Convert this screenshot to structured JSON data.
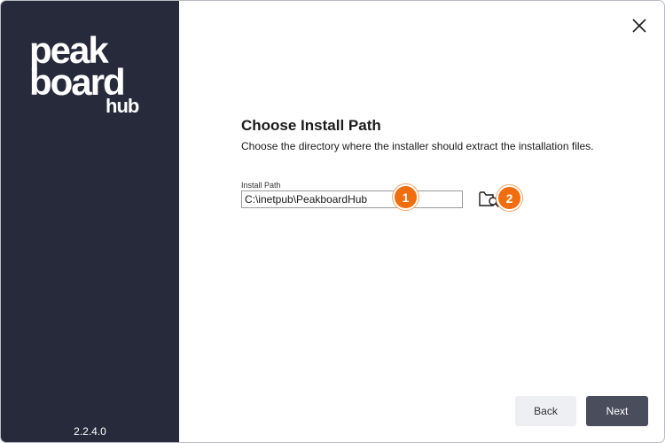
{
  "app": {
    "logo_text": "peakboard hub",
    "version": "2.2.4.0"
  },
  "page": {
    "title": "Choose Install Path",
    "subtitle": "Choose the directory where the installer should extract the installation files."
  },
  "install_path": {
    "label": "Install Path",
    "value": "C:\\inetpub\\PeakboardHub"
  },
  "markers": [
    "1",
    "2"
  ],
  "buttons": {
    "back": "Back",
    "next": "Next"
  },
  "icons": {
    "close": "close-icon",
    "browse": "folder-search-icon"
  },
  "colors": {
    "sidebar": "#272a3b",
    "marker": "#f26d0d",
    "next_button": "#4a4d5b",
    "back_button": "#eeeff2"
  }
}
